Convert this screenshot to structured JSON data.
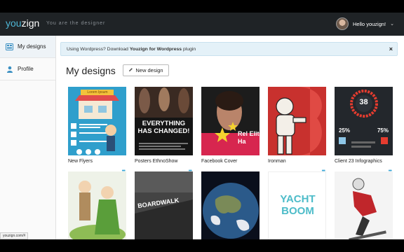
{
  "header": {
    "logo_you": "you",
    "logo_zign": "zign",
    "tagline": "You are the designer",
    "greeting": "Hello youzign!",
    "caret_icon": "chevron-down-icon"
  },
  "sidebar": {
    "items": [
      {
        "label": "My designs",
        "icon": "grid-icon"
      },
      {
        "label": "Profile",
        "icon": "user-icon"
      }
    ]
  },
  "banner": {
    "text_before": "Using Wordpress? Download",
    "link_bold": "Youzign for Wordpress",
    "text_after": "plugin",
    "close": "×"
  },
  "main": {
    "title": "My designs",
    "new_button": "New design"
  },
  "designs": [
    {
      "caption": "New Flyers",
      "thumb_text": "Lorem Ipsum",
      "accent": "#2f9fcc"
    },
    {
      "caption": "Posters EthnoShow",
      "thumb_text": "EVERYTHING HAS CHANGED!",
      "accent": "#111111"
    },
    {
      "caption": "Facebook Cover",
      "thumb_text": "Rel Elite Ha",
      "accent": "#d7264f"
    },
    {
      "caption": "Ironman",
      "thumb_text": "",
      "accent": "#c8312e"
    },
    {
      "caption": "Client 23 Infographics",
      "thumb_text": "38",
      "stat1": "25%",
      "stat2": "75%",
      "accent": "#e53c2f"
    },
    {
      "caption": "",
      "thumb_text": "",
      "accent": "#8ebc55"
    },
    {
      "caption": "",
      "thumb_text": "BOARDWALK",
      "accent": "#3b3b3b"
    },
    {
      "caption": "",
      "thumb_text": "",
      "accent": "#2b5a8a"
    },
    {
      "caption": "",
      "thumb_text": "YACHT BOOM",
      "accent": "#4dbcc9"
    },
    {
      "caption": "",
      "thumb_text": "",
      "accent": "#c0262b"
    }
  ],
  "statusbar": "youzign.com/#"
}
